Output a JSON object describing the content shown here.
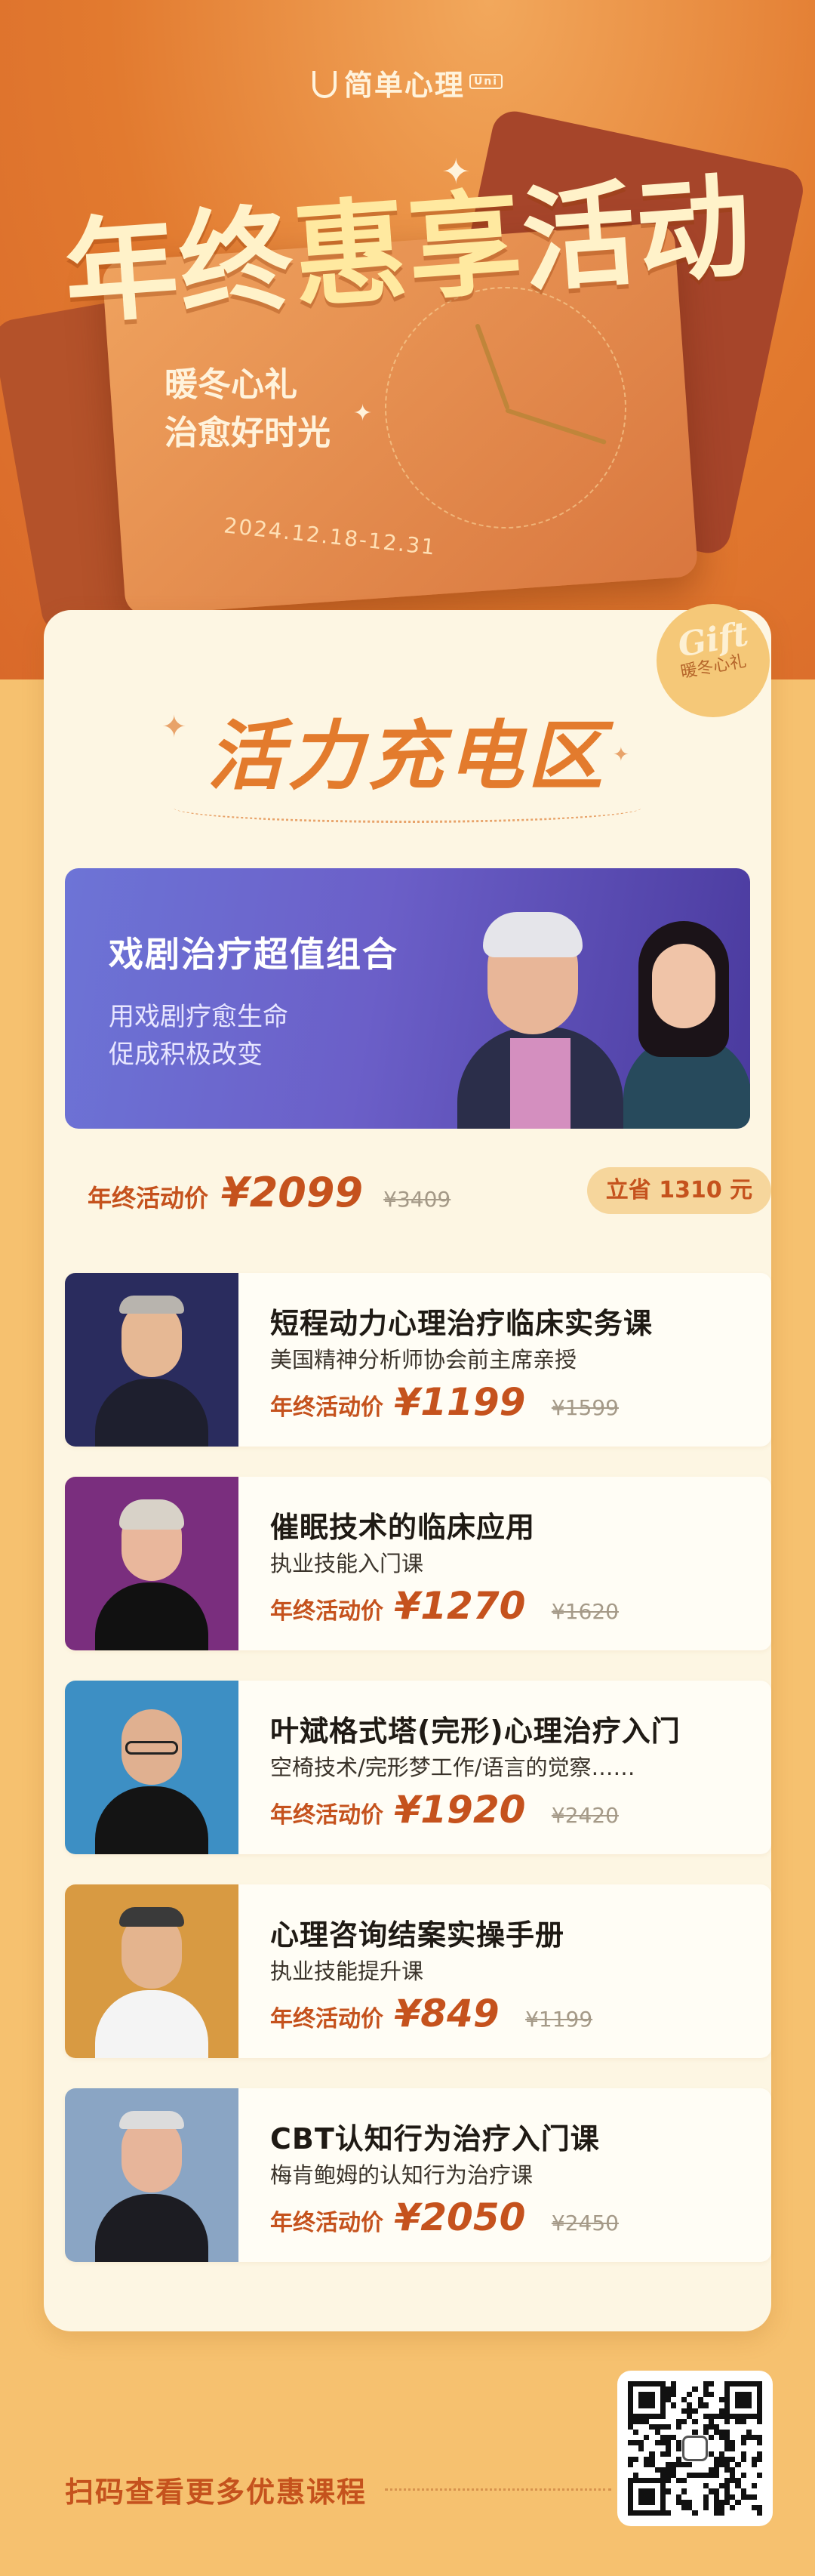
{
  "brand": {
    "name": "简单心理",
    "badge": "Uni"
  },
  "hero": {
    "title_a": "年终",
    "title_b": "惠享",
    "title_c": "活动",
    "sub_line1": "暖冬心礼",
    "sub_line2": "治愈好时光",
    "date": "2024.12.18-12.31"
  },
  "gift": {
    "label": "Gift",
    "sub": "暖冬心礼"
  },
  "section": {
    "title": "活力充电区"
  },
  "feature": {
    "title": "戏剧治疗超值组合",
    "sub1": "用戏剧疗愈生命",
    "sub2": "促成积极改变",
    "price_label": "年终活动价",
    "currency": "¥",
    "price": "2099",
    "old_price": "¥3409",
    "save": "立省 1310 元"
  },
  "courses": [
    {
      "title": "短程动力心理治疗临床实务课",
      "sub": "美国精神分析师协会前主席亲授",
      "price_label": "年终活动价",
      "currency": "¥",
      "price": "1199",
      "old_price": "¥1599"
    },
    {
      "title": "催眠技术的临床应用",
      "sub": "执业技能入门课",
      "price_label": "年终活动价",
      "currency": "¥",
      "price": "1270",
      "old_price": "¥1620"
    },
    {
      "title": "叶斌格式塔(完形)心理治疗入门",
      "sub": "空椅技术/完形梦工作/语言的觉察……",
      "price_label": "年终活动价",
      "currency": "¥",
      "price": "1920",
      "old_price": "¥2420"
    },
    {
      "title": "心理咨询结案实操手册",
      "sub": "执业技能提升课",
      "price_label": "年终活动价",
      "currency": "¥",
      "price": "849",
      "old_price": "¥1199"
    },
    {
      "title": "CBT认知行为治疗入门课",
      "sub": "梅肯鲍姆的认知行为治疗课",
      "price_label": "年终活动价",
      "currency": "¥",
      "price": "2050",
      "old_price": "¥2450"
    }
  ],
  "footer": {
    "text": "扫码查看更多优惠课程"
  },
  "colors": {
    "accent": "#c5521d",
    "panel": "#fdf6e3",
    "hero": "#e27a2f",
    "banner": "#6b5fc8"
  }
}
